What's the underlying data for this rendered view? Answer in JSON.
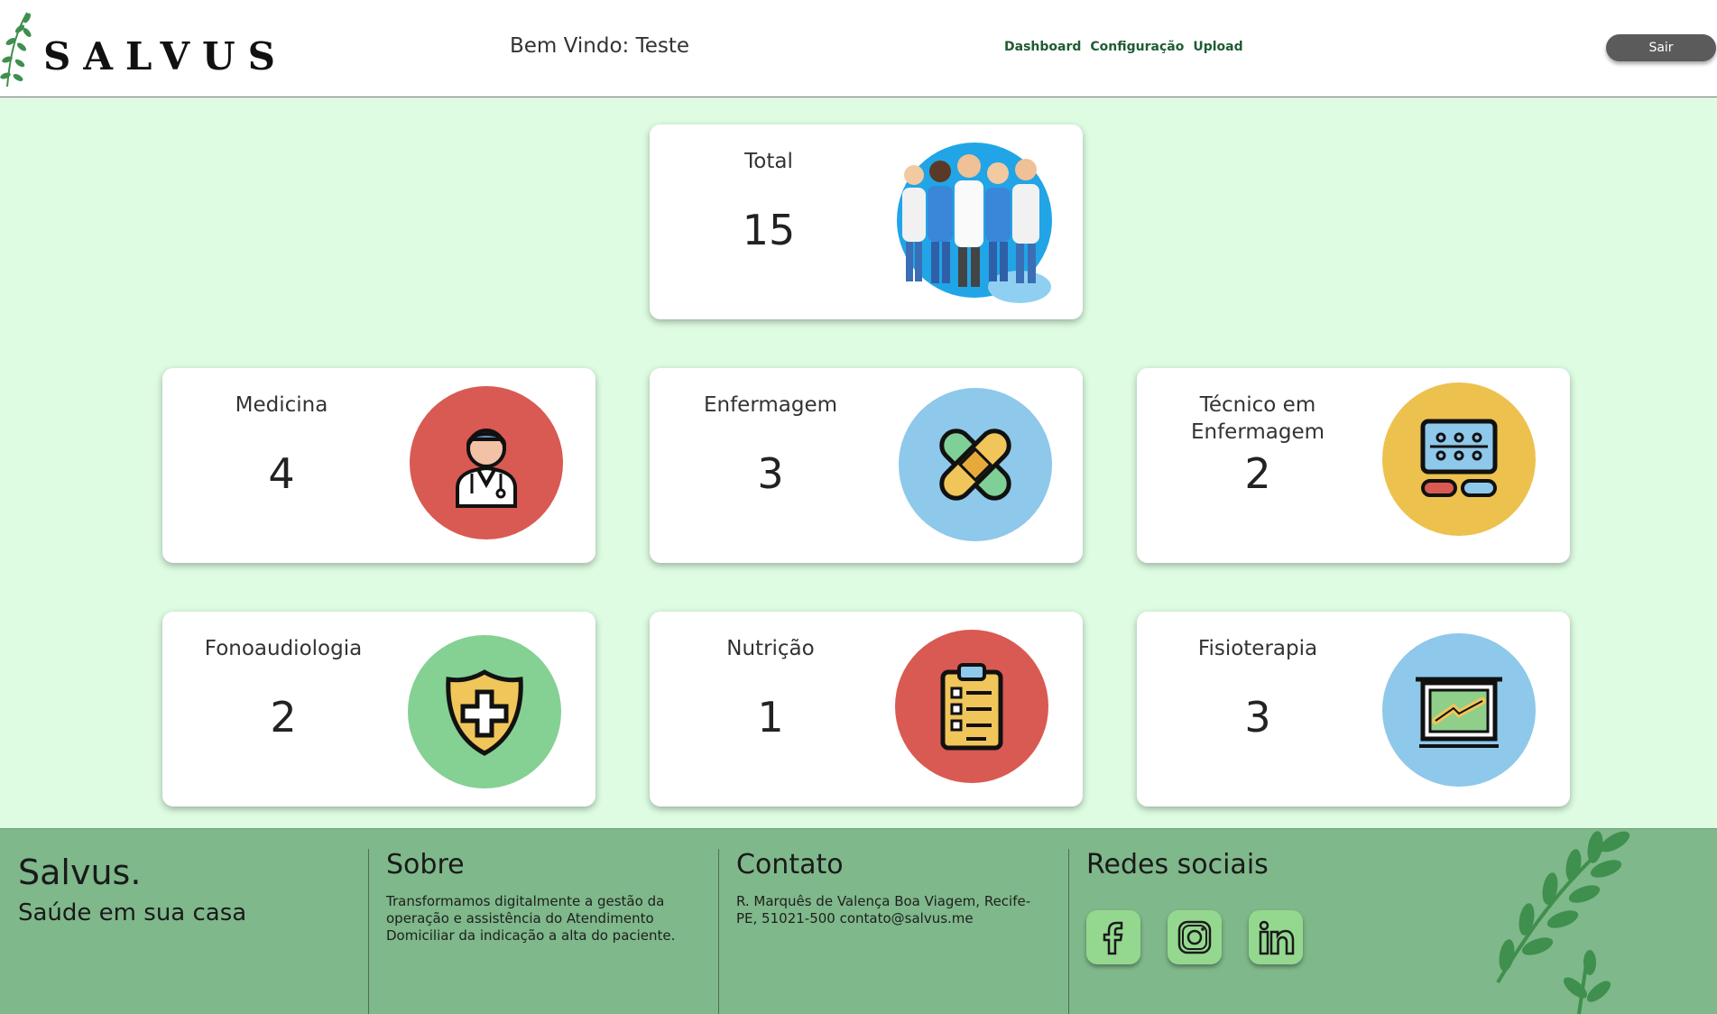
{
  "header": {
    "brand": "SALVUS",
    "welcome": "Bem Vindo: Teste",
    "nav": [
      "Dashboard",
      "Configuração",
      "Upload"
    ],
    "logout_label": "Sair"
  },
  "total_card": {
    "label": "Total",
    "value": "15",
    "icon": "medical-team-illustration"
  },
  "cards": [
    {
      "label": "Medicina",
      "value": "4",
      "icon": "doctor-icon",
      "color": "#d85a52"
    },
    {
      "label": "Enfermagem",
      "value": "3",
      "icon": "bandage-icon",
      "color": "#8ec8ea"
    },
    {
      "label": "Técnico em Enfermagem",
      "value": "2",
      "icon": "medical-device-icon",
      "color": "#ecc14e"
    },
    {
      "label": "Fonoaudiologia",
      "value": "2",
      "icon": "shield-plus-icon",
      "color": "#85d093"
    },
    {
      "label": "Nutrição",
      "value": "1",
      "icon": "clipboard-checklist-icon",
      "color": "#d85a52"
    },
    {
      "label": "Fisioterapia",
      "value": "3",
      "icon": "xray-joint-icon",
      "color": "#8ec8ea"
    }
  ],
  "footer": {
    "brand": "Salvus.",
    "tagline": "Saúde em sua casa",
    "about_title": "Sobre",
    "about_text": "Transformamos digitalmente a gestão da operação e assistência do Atendimento Domiciliar da indicação a alta do paciente.",
    "contact_title": "Contato",
    "contact_text": "R. Marquês de Valença Boa Viagem, Recife-PE, 51021-500 contato@salvus.me",
    "social_title": "Redes sociais",
    "social": [
      "facebook-icon",
      "instagram-icon",
      "linkedin-icon"
    ]
  }
}
